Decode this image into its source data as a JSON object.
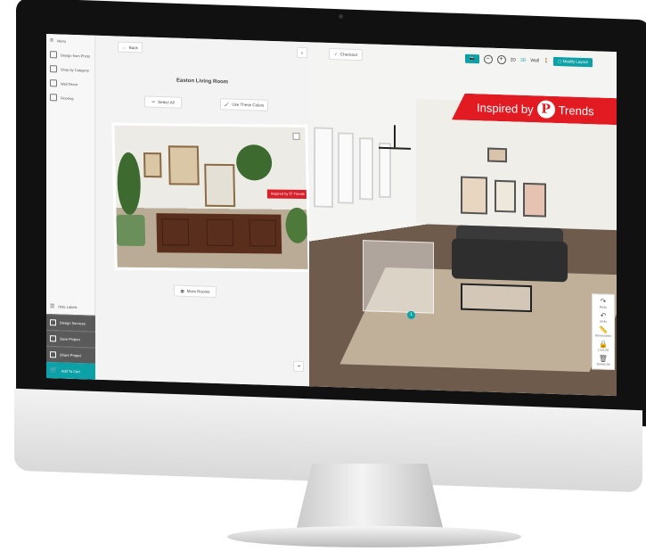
{
  "sidebar": {
    "menu_label": "Menu",
    "items": [
      {
        "label": "Design from Photo",
        "icon": "image-icon"
      },
      {
        "label": "Shop by Category",
        "icon": "shop-icon"
      },
      {
        "label": "Wall Decor",
        "icon": "frame-icon"
      },
      {
        "label": "Flooring",
        "icon": "flooring-icon"
      }
    ],
    "hide_labels": "Hide Labels",
    "design_services": "Design Services",
    "save_project": "Save Project",
    "share_project": "Share Project",
    "add_to_cart": "Add To Cart"
  },
  "panel": {
    "back_label": "Back",
    "room_title": "Easton Living Room",
    "select_all": "Select All",
    "use_colors": "Use These Colors",
    "more_rooms": "More Rooms",
    "photo_tag": "Inspired by",
    "photo_tag_trends": "Trends"
  },
  "view": {
    "checkout": "Checkout",
    "mode_2d": "2D",
    "mode_3d": "3D",
    "mode_wall": "Wall",
    "modify_layout": "Modify Layout",
    "banner_prefix": "Inspired by",
    "banner_logo": "P",
    "banner_suffix": "Trends",
    "marker_number": "1"
  },
  "tools": {
    "redo": "Redo",
    "undo": "Undo",
    "dimensions": "Dimensions",
    "lock_all": "Lock All",
    "delete_all": "Delete All"
  },
  "colors": {
    "accent": "#0ca0a7",
    "banner": "#e21b23",
    "dark_button": "#5a5a5a"
  }
}
